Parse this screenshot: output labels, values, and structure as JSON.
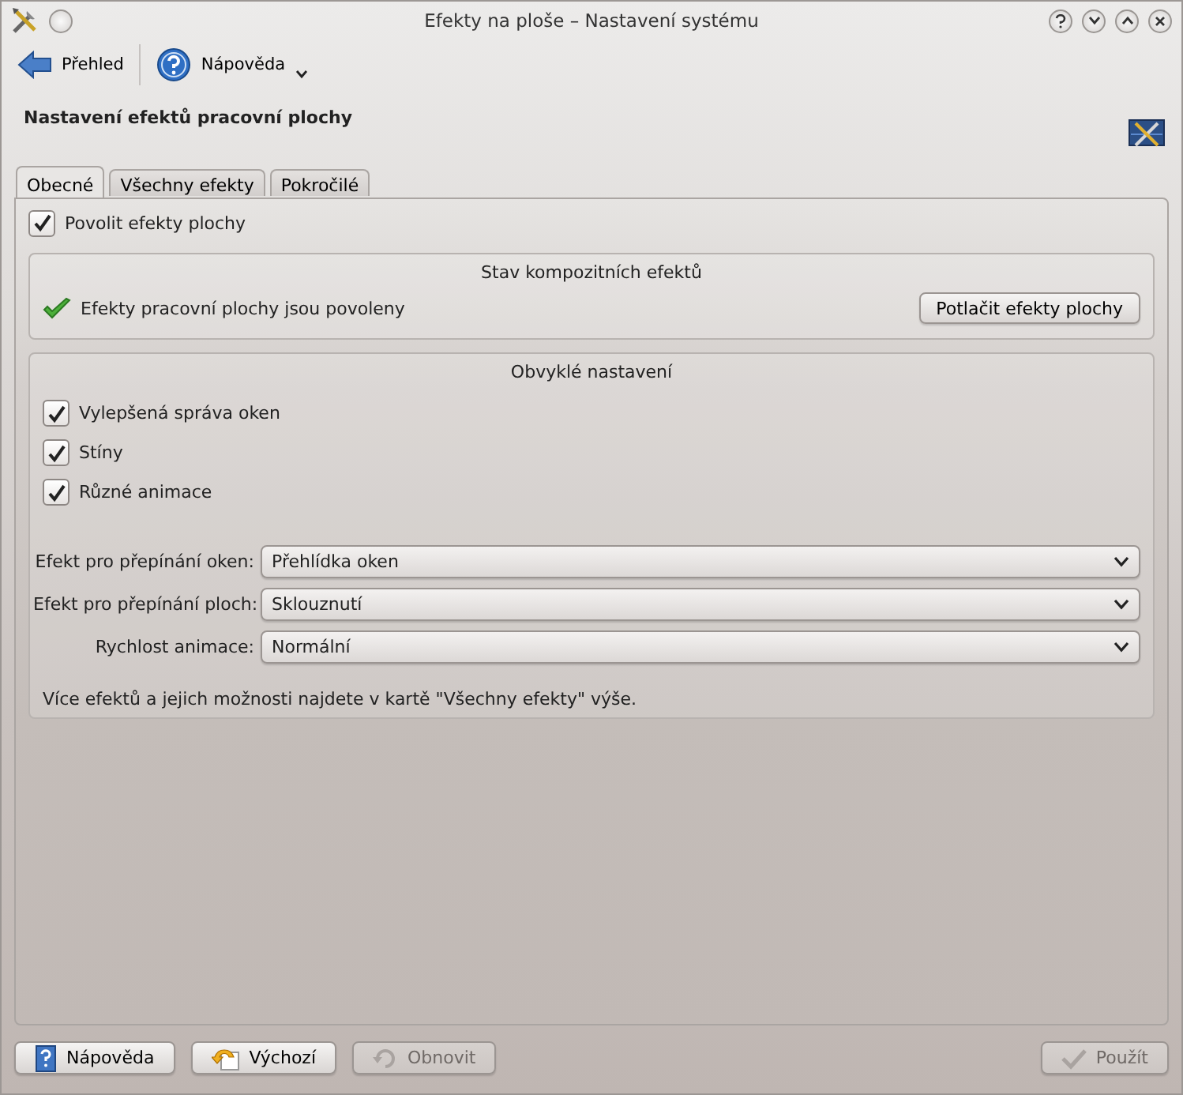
{
  "window": {
    "title": "Efekty na ploše – Nastavení systému"
  },
  "toolbar": [
    {
      "kind": "back",
      "label": "Přehled"
    },
    {
      "kind": "help",
      "label": "Nápověda"
    }
  ],
  "heading": "Nastavení efektů pracovní plochy",
  "tabs": [
    {
      "label": "Obecné",
      "selected": true
    },
    {
      "label": "Všechny efekty",
      "selected": false
    },
    {
      "label": "Pokročilé",
      "selected": false
    }
  ],
  "enable": {
    "label": "Povolit efekty plochy",
    "checked": true
  },
  "status_group": {
    "title": "Stav kompozitních efektů",
    "status": "Efekty pracovní plochy jsou povoleny",
    "button": "Potlačit efekty plochy"
  },
  "common_group": {
    "title": "Obvyklé nastavení",
    "checks": [
      {
        "label": "Vylepšená správa oken",
        "checked": true
      },
      {
        "label": "Stíny",
        "checked": true
      },
      {
        "label": "Různé animace",
        "checked": true
      }
    ],
    "combos": [
      {
        "label": "Efekt pro přepínání oken:",
        "value": "Přehlídka oken"
      },
      {
        "label": "Efekt pro přepínání ploch:",
        "value": "Sklouznutí"
      },
      {
        "label": "Rychlost animace:",
        "value": "Normální"
      }
    ],
    "note": "Více efektů a jejich možnosti najdete v kartě \"Všechny efekty\" výše."
  },
  "buttons": [
    {
      "kind": "help",
      "label": "Nápověda",
      "disabled": false
    },
    {
      "kind": "defaults",
      "label": "Výchozí",
      "disabled": false
    },
    {
      "kind": "reset",
      "label": "Obnovit",
      "disabled": true
    },
    {
      "kind": "apply",
      "label": "Použít",
      "disabled": true
    }
  ]
}
